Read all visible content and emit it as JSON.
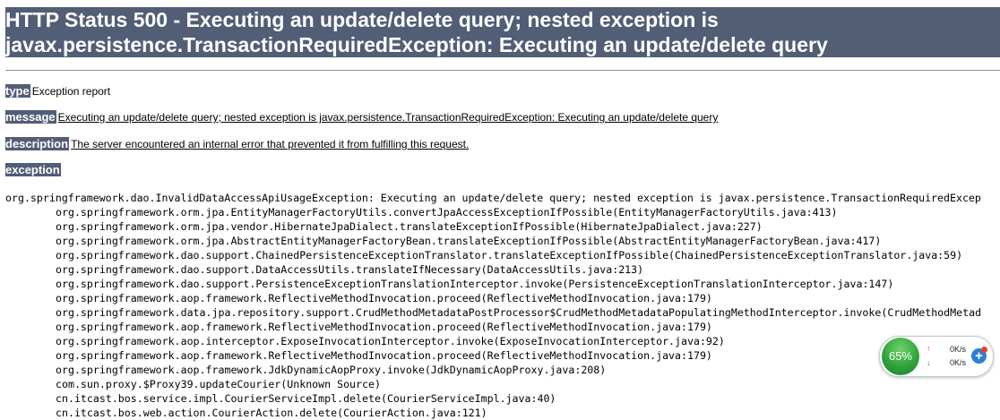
{
  "header": {
    "title_line1": "HTTP Status 500 - Executing an update/delete query; nested exception is",
    "title_line2": "javax.persistence.TransactionRequiredException: Executing an update/delete query"
  },
  "fields": {
    "type": {
      "label": "type",
      "value": "Exception report"
    },
    "message": {
      "label": "message",
      "value": "Executing an update/delete query; nested exception is javax.persistence.TransactionRequiredException: Executing an update/delete query"
    },
    "description": {
      "label": "description",
      "value": "The server encountered an internal error that prevented it from fulfilling this request."
    },
    "exception": {
      "label": "exception"
    }
  },
  "stacktrace": {
    "first_line": "org.springframework.dao.InvalidDataAccessApiUsageException: Executing an update/delete query; nested exception is javax.persistence.TransactionRequiredExcep",
    "frames": [
      "org.springframework.orm.jpa.EntityManagerFactoryUtils.convertJpaAccessExceptionIfPossible(EntityManagerFactoryUtils.java:413)",
      "org.springframework.orm.jpa.vendor.HibernateJpaDialect.translateExceptionIfPossible(HibernateJpaDialect.java:227)",
      "org.springframework.orm.jpa.AbstractEntityManagerFactoryBean.translateExceptionIfPossible(AbstractEntityManagerFactoryBean.java:417)",
      "org.springframework.dao.support.ChainedPersistenceExceptionTranslator.translateExceptionIfPossible(ChainedPersistenceExceptionTranslator.java:59)",
      "org.springframework.dao.support.DataAccessUtils.translateIfNecessary(DataAccessUtils.java:213)",
      "org.springframework.dao.support.PersistenceExceptionTranslationInterceptor.invoke(PersistenceExceptionTranslationInterceptor.java:147)",
      "org.springframework.aop.framework.ReflectiveMethodInvocation.proceed(ReflectiveMethodInvocation.java:179)",
      "org.springframework.data.jpa.repository.support.CrudMethodMetadataPostProcessor$CrudMethodMetadataPopulatingMethodInterceptor.invoke(CrudMethodMetad",
      "org.springframework.aop.framework.ReflectiveMethodInvocation.proceed(ReflectiveMethodInvocation.java:179)",
      "org.springframework.aop.interceptor.ExposeInvocationInterceptor.invoke(ExposeInvocationInterceptor.java:92)",
      "org.springframework.aop.framework.ReflectiveMethodInvocation.proceed(ReflectiveMethodInvocation.java:179)",
      "org.springframework.aop.framework.JdkDynamicAopProxy.invoke(JdkDynamicAopProxy.java:208)",
      "com.sun.proxy.$Proxy39.updateCourier(Unknown Source)",
      "cn.itcast.bos.service.impl.CourierServiceImpl.delete(CourierServiceImpl.java:40)",
      "cn.itcast.bos.web.action.CourierAction.delete(CourierAction.java:121)"
    ]
  },
  "net_widget": {
    "percent": "65%",
    "upload_speed": "0K/s",
    "download_speed": "0K/s",
    "up_arrow": "↑",
    "down_arrow": "↓",
    "plus": "+",
    "colors": {
      "ball": "#2fa33a",
      "up": "#e23b2c",
      "down": "#2e9e3e",
      "plus": "#2b7fd6",
      "dot": "#e8402f"
    }
  },
  "colors": {
    "label_background": "#525d76",
    "label_text": "#ffffff"
  }
}
